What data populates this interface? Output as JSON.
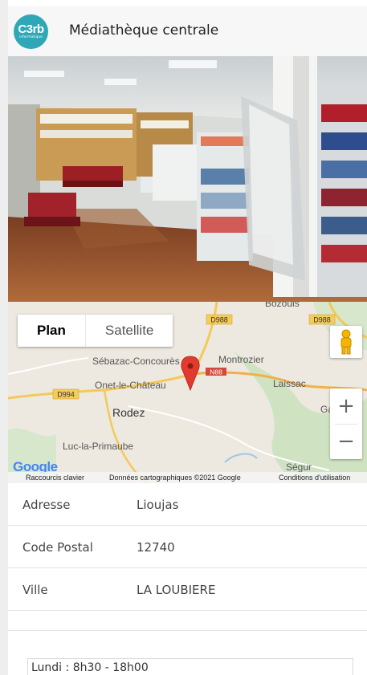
{
  "header": {
    "title": "Médiathèque centrale",
    "logo_text": "C3rb",
    "logo_subtext": "informatique"
  },
  "map": {
    "tabs": [
      {
        "label": "Plan"
      },
      {
        "label": "Satellite"
      }
    ],
    "active_tab": "Plan",
    "places": [
      "Bozouls",
      "Sébazac-Concourès",
      "Montrozier",
      "Onet-le-Château",
      "Laissac",
      "Rodez",
      "Luc-la-Primaube",
      "Ségur",
      "Gaillac"
    ],
    "roads": [
      "D988",
      "D988",
      "N88",
      "D994"
    ],
    "zoom_in": "+",
    "zoom_out": "−",
    "footer": {
      "shortcuts": "Raccourcis clavier",
      "data": "Données cartographiques ©2021 Google",
      "terms": "Conditions d'utilisation"
    },
    "brand": "Google"
  },
  "details": [
    {
      "label": "Adresse",
      "value": "Lioujas"
    },
    {
      "label": "Code Postal",
      "value": "12740"
    },
    {
      "label": "Ville",
      "value": "LA LOUBIERE"
    }
  ],
  "hours": [
    "Lundi : 8h30 - 18h00"
  ]
}
